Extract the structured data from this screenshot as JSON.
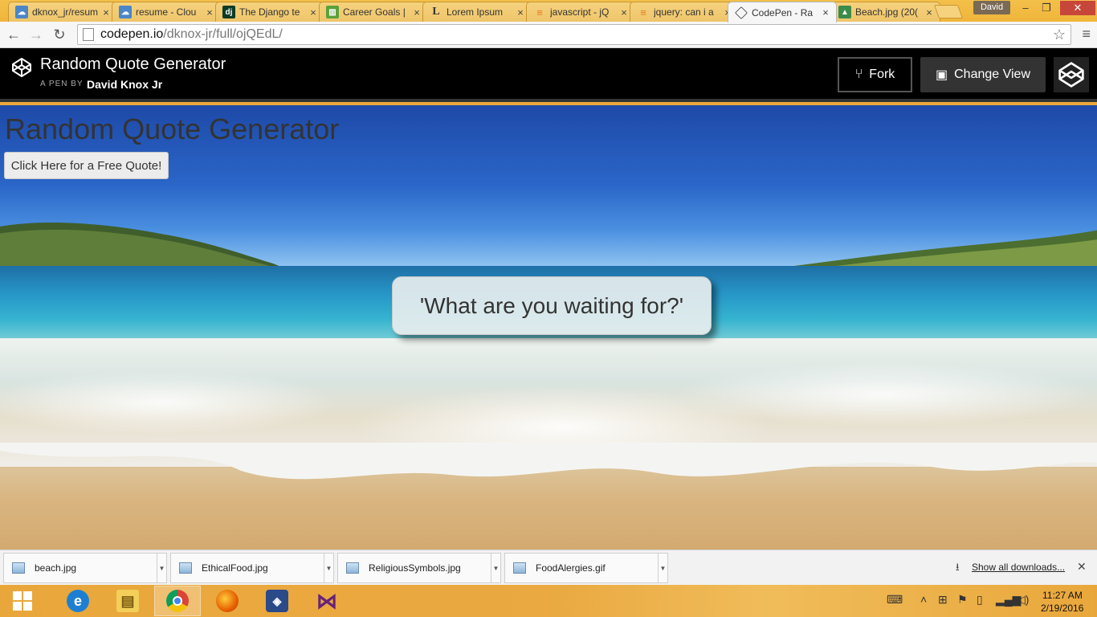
{
  "browser": {
    "tabs": [
      {
        "title": "dknox_jr/resum",
        "icon": "cloud-icon"
      },
      {
        "title": "resume - Clou",
        "icon": "cloud-icon"
      },
      {
        "title": "The Django te",
        "icon": "django-icon"
      },
      {
        "title": "Career Goals |",
        "icon": "trello-icon"
      },
      {
        "title": "Lorem Ipsum",
        "icon": "lorem-icon"
      },
      {
        "title": "javascript - jQ",
        "icon": "stackoverflow-icon"
      },
      {
        "title": "jquery: can i a",
        "icon": "stackoverflow-icon"
      },
      {
        "title": "CodePen - Ra",
        "icon": "codepen-icon"
      },
      {
        "title": "Beach.jpg (20(",
        "icon": "image-icon"
      }
    ],
    "active_tab_index": 7,
    "user_name": "David",
    "url_domain": "codepen.io",
    "url_path": "/dknox-jr/full/ojQEdL/"
  },
  "codepen": {
    "pen_title": "Random Quote Generator",
    "byline": "A PEN BY",
    "author": "David Knox Jr",
    "fork_label": "Fork",
    "change_view_label": "Change View"
  },
  "page": {
    "heading": "Random Quote Generator",
    "button_label": "Click Here for a Free Quote!",
    "quote": "'What are you waiting for?'"
  },
  "downloads": {
    "items": [
      "beach.jpg",
      "EthicalFood.jpg",
      "ReligiousSymbols.jpg",
      "FoodAlergies.gif"
    ],
    "show_all": "Show all downloads..."
  },
  "taskbar": {
    "apps": [
      "internet-explorer-icon",
      "file-explorer-icon",
      "chrome-icon",
      "firefox-icon",
      "virtualbox-icon",
      "visual-studio-icon"
    ],
    "active_app": "chrome-icon",
    "time": "11:27 AM",
    "date": "2/19/2016"
  },
  "colors": {
    "taskbar": "#e9a73b",
    "codepen_header": "#000000",
    "sky": "#2a66c8",
    "sea": "#2797c8",
    "sand": "#d9b47f"
  }
}
